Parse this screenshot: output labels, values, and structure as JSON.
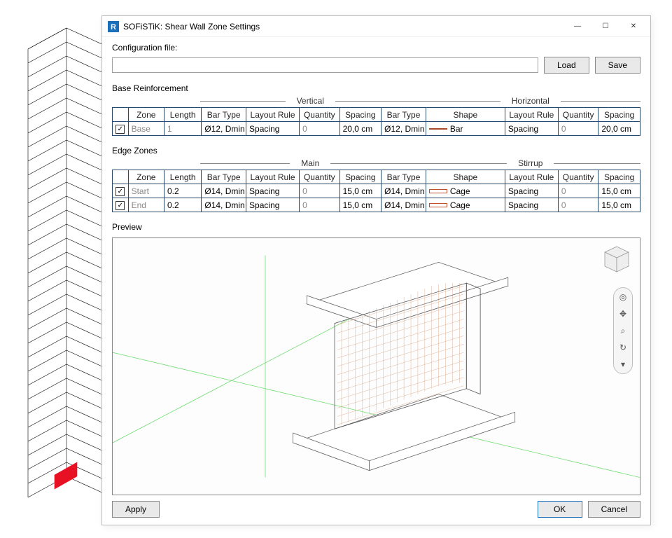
{
  "window": {
    "title": "SOFiSTiK: Shear Wall Zone Settings",
    "app_icon_letter": "R"
  },
  "config": {
    "label": "Configuration file:",
    "value": "",
    "load": "Load",
    "save": "Save"
  },
  "base": {
    "title": "Base Reinforcement",
    "groups": {
      "left": "Vertical",
      "right": "Horizontal"
    },
    "headers": [
      "Zone",
      "Length",
      "Bar Type",
      "Layout Rule",
      "Quantity",
      "Spacing",
      "Bar Type",
      "Shape",
      "Layout Rule",
      "Quantity",
      "Spacing"
    ],
    "rows": [
      {
        "checked": true,
        "zone": "Base",
        "length": "1",
        "bt": "Ø12, Dmin",
        "lr": "Spacing",
        "qty": "0",
        "sp": "20,0 cm",
        "bt2": "Ø12, Dmin",
        "shape": "Bar",
        "lr2": "Spacing",
        "qty2": "0",
        "sp2": "20,0 cm"
      }
    ]
  },
  "edge": {
    "title": "Edge Zones",
    "groups": {
      "left": "Main",
      "right": "Stirrup"
    },
    "headers": [
      "Zone",
      "Length",
      "Bar Type",
      "Layout Rule",
      "Quantity",
      "Spacing",
      "Bar Type",
      "Shape",
      "Layout Rule",
      "Quantity",
      "Spacing"
    ],
    "rows": [
      {
        "checked": true,
        "zone": "Start",
        "length": "0.2",
        "bt": "Ø14, Dmin",
        "lr": "Spacing",
        "qty": "0",
        "sp": "15,0 cm",
        "bt2": "Ø14, Dmin",
        "shape": "Cage",
        "lr2": "Spacing",
        "qty2": "0",
        "sp2": "15,0 cm"
      },
      {
        "checked": true,
        "zone": "End",
        "length": "0.2",
        "bt": "Ø14, Dmin",
        "lr": "Spacing",
        "qty": "0",
        "sp": "15,0 cm",
        "bt2": "Ø14, Dmin",
        "shape": "Cage",
        "lr2": "Spacing",
        "qty2": "0",
        "sp2": "15,0 cm"
      }
    ]
  },
  "preview": {
    "label": "Preview"
  },
  "buttons": {
    "apply": "Apply",
    "ok": "OK",
    "cancel": "Cancel"
  }
}
